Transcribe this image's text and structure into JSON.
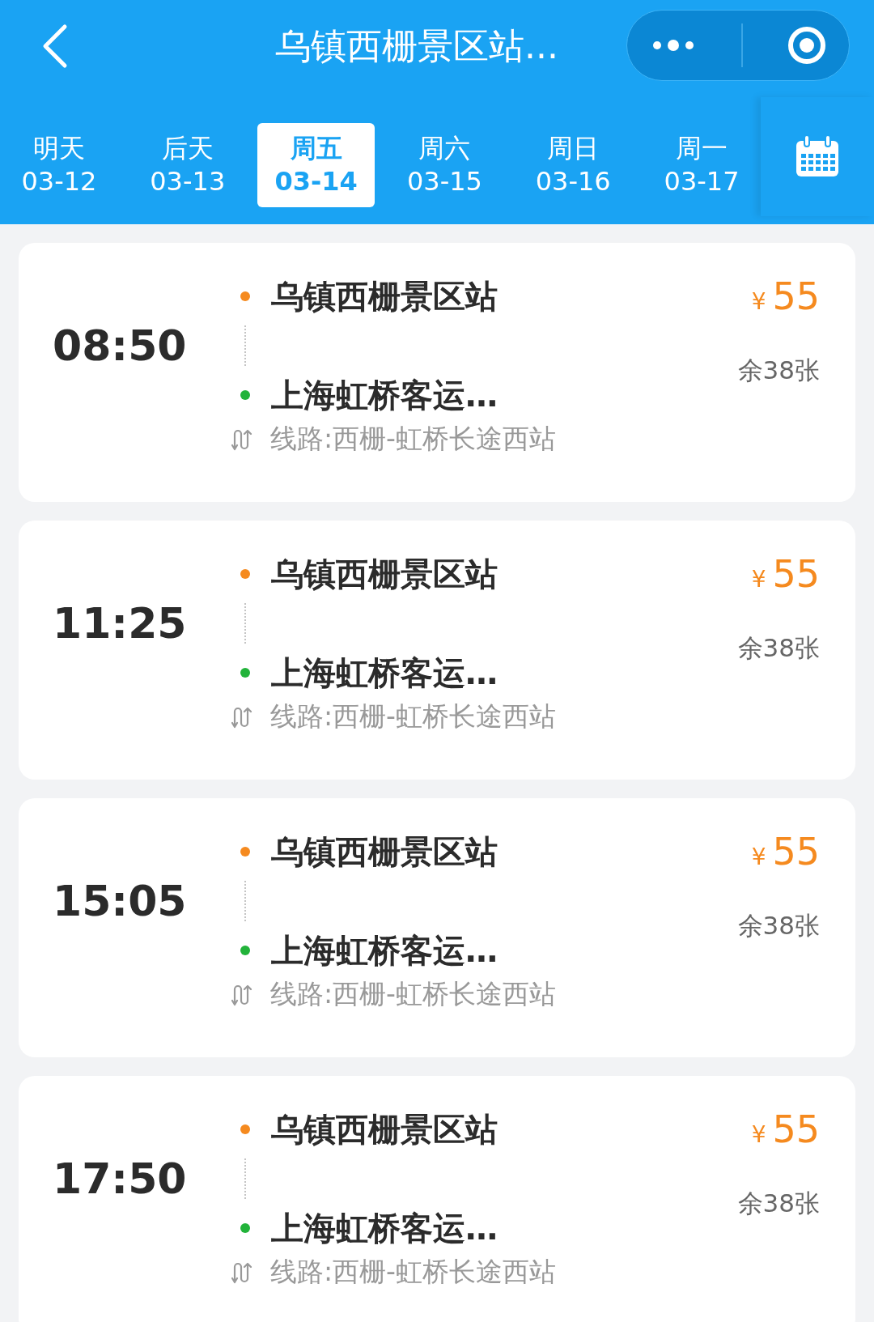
{
  "nav": {
    "title": "乌镇西栅景区站..."
  },
  "date_tabs": [
    {
      "day": "明天",
      "date": "03-12",
      "selected": false
    },
    {
      "day": "后天",
      "date": "03-13",
      "selected": false
    },
    {
      "day": "周五",
      "date": "03-14",
      "selected": true
    },
    {
      "day": "周六",
      "date": "03-15",
      "selected": false
    },
    {
      "day": "周日",
      "date": "03-16",
      "selected": false
    },
    {
      "day": "周一",
      "date": "03-17",
      "selected": false
    }
  ],
  "trips": [
    {
      "time": "08:50",
      "from": "乌镇西栅景区站",
      "to": "上海虹桥客运…",
      "route": "线路:西栅-虹桥长途西站",
      "currency": "¥",
      "price": "55",
      "remaining": "余38张"
    },
    {
      "time": "11:25",
      "from": "乌镇西栅景区站",
      "to": "上海虹桥客运…",
      "route": "线路:西栅-虹桥长途西站",
      "currency": "¥",
      "price": "55",
      "remaining": "余38张"
    },
    {
      "time": "15:05",
      "from": "乌镇西栅景区站",
      "to": "上海虹桥客运…",
      "route": "线路:西栅-虹桥长途西站",
      "currency": "¥",
      "price": "55",
      "remaining": "余38张"
    },
    {
      "time": "17:50",
      "from": "乌镇西栅景区站",
      "to": "上海虹桥客运…",
      "route": "线路:西栅-虹桥长途西站",
      "currency": "¥",
      "price": "55",
      "remaining": "余38张"
    }
  ]
}
